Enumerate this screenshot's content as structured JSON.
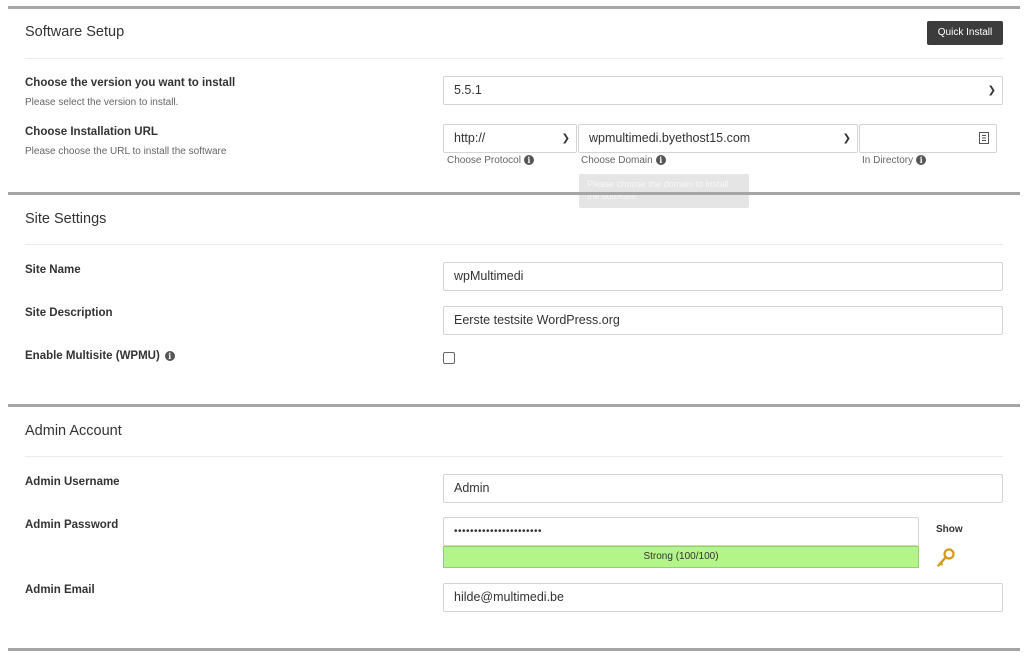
{
  "software_setup": {
    "title": "Software Setup",
    "quick_install_label": "Quick Install",
    "version_label": "Choose the version you want to install",
    "version_help": "Please select the version to install.",
    "version_value": "5.5.1",
    "url_label": "Choose Installation URL",
    "url_help": "Please choose the URL to install the software",
    "protocol_value": "http://",
    "protocol_hint": "Choose Protocol",
    "domain_value": "wpmultimedi.byethost15.com",
    "domain_hint": "Choose Domain",
    "directory_value": "",
    "directory_hint": "In Directory",
    "tooltip_text": "Please choose the domain to install the software."
  },
  "site_settings": {
    "title": "Site Settings",
    "site_name_label": "Site Name",
    "site_name_value": "wpMultimedi",
    "site_description_label": "Site Description",
    "site_description_value": "Eerste testsite WordPress.org",
    "multisite_label": "Enable Multisite (WPMU)",
    "multisite_checked": false
  },
  "admin_account": {
    "title": "Admin Account",
    "username_label": "Admin Username",
    "username_value": "Admin",
    "password_label": "Admin Password",
    "password_value": "••••••••••••••••••••••",
    "show_label": "Show",
    "strength_text": "Strong (100/100)",
    "strength_color": "#b4f58a",
    "email_label": "Admin Email",
    "email_value": "hilde@multimedi.be"
  },
  "icons": {
    "info": "info-icon",
    "chevron": "chevron-down-icon",
    "key": "key-icon",
    "list": "list-icon"
  }
}
